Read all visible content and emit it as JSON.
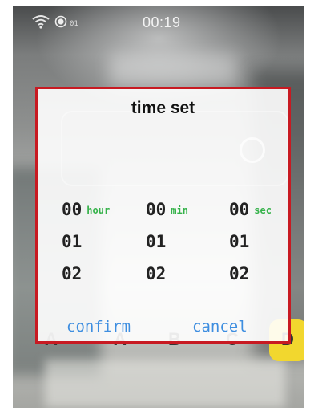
{
  "status_bar": {
    "rec_label": "01",
    "time": "00:19"
  },
  "keypad_keys": [
    "A",
    "A",
    "B",
    "C",
    "D"
  ],
  "dialog": {
    "title": "time set",
    "columns": [
      {
        "unit": "hour",
        "values": [
          "00",
          "01",
          "02"
        ]
      },
      {
        "unit": "min",
        "values": [
          "00",
          "01",
          "02"
        ]
      },
      {
        "unit": "sec",
        "values": [
          "00",
          "01",
          "02"
        ]
      }
    ],
    "confirm_label": "confirm",
    "cancel_label": "cancel"
  },
  "colors": {
    "dialog_border": "#c81a22",
    "unit_text": "#35b24a",
    "button_text": "#3e8ee0",
    "key_highlight": "#f2d72e"
  }
}
